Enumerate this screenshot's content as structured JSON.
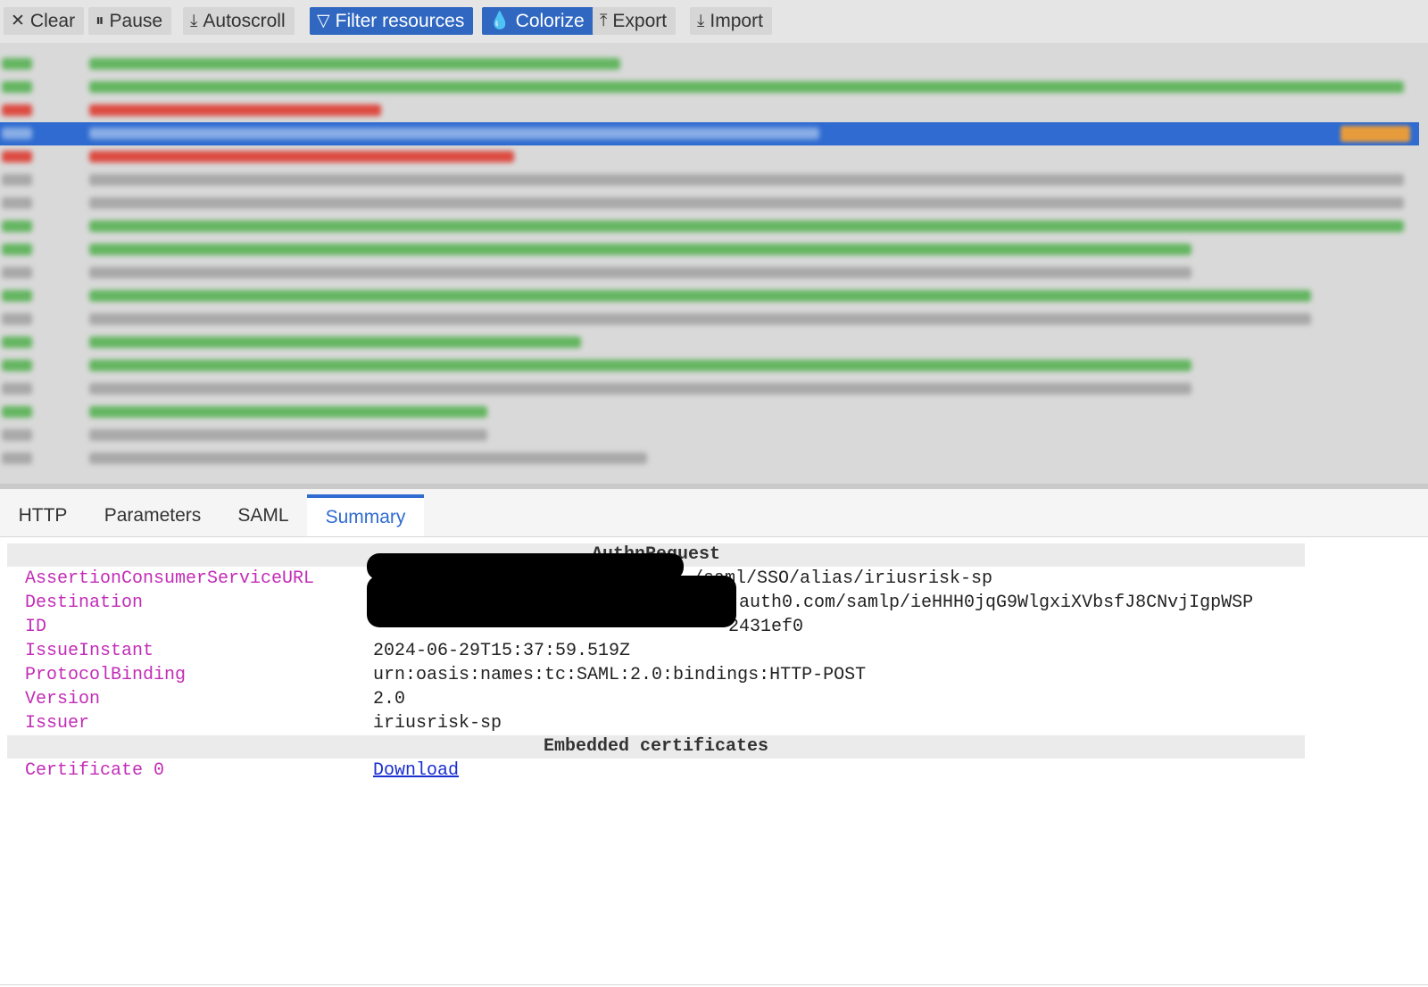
{
  "toolbar": {
    "clear_label": "Clear",
    "pause_label": "Pause",
    "autoscroll_label": "Autoscroll",
    "filter_label": "Filter resources",
    "colorize_label": "Colorize",
    "export_label": "Export",
    "import_label": "Import",
    "active_color": "#2f67c1"
  },
  "request_list": {
    "note_colors": {
      "green": "#63b560",
      "red": "#dc4a40",
      "grey": "#a8a8a8",
      "selected": "#2f6bd0"
    },
    "rows": [
      {
        "color": "green",
        "url_length": 0.4,
        "selected": false
      },
      {
        "color": "green",
        "url_length": 0.99,
        "selected": false
      },
      {
        "color": "red",
        "url_length": 0.22,
        "selected": false
      },
      {
        "color": "blue",
        "url_length": 0.55,
        "selected": true
      },
      {
        "color": "red",
        "url_length": 0.32,
        "selected": false
      },
      {
        "color": "grey",
        "url_length": 0.99,
        "selected": false
      },
      {
        "color": "grey",
        "url_length": 0.99,
        "selected": false
      },
      {
        "color": "green",
        "url_length": 0.99,
        "selected": false
      },
      {
        "color": "green",
        "url_length": 0.83,
        "selected": false
      },
      {
        "color": "grey",
        "url_length": 0.83,
        "selected": false
      },
      {
        "color": "green",
        "url_length": 0.92,
        "selected": false
      },
      {
        "color": "grey",
        "url_length": 0.92,
        "selected": false
      },
      {
        "color": "green",
        "url_length": 0.37,
        "selected": false
      },
      {
        "color": "green",
        "url_length": 0.83,
        "selected": false
      },
      {
        "color": "grey",
        "url_length": 0.83,
        "selected": false
      },
      {
        "color": "green",
        "url_length": 0.3,
        "selected": false
      },
      {
        "color": "grey",
        "url_length": 0.3,
        "selected": false
      },
      {
        "color": "grey",
        "url_length": 0.42,
        "selected": false
      }
    ]
  },
  "tabs": {
    "http": "HTTP",
    "parameters": "Parameters",
    "saml": "SAML",
    "summary": "Summary",
    "active": "Summary"
  },
  "summary": {
    "authn_header": "AuthnRequest",
    "fields": {
      "acs_key": "AssertionConsumerServiceURL",
      "acs_value": "/saml/SSO/alias/iriusrisk-sp",
      "destination_key": "Destination",
      "destination_value": "auth0.com/samlp/ieHHH0jqG9WlgxiXVbsfJ8CNvjIgpWSP",
      "id_key": "ID",
      "id_value": "2431ef0",
      "issue_instant_key": "IssueInstant",
      "issue_instant_value": "2024-06-29T15:37:59.519Z",
      "protocol_binding_key": "ProtocolBinding",
      "protocol_binding_value": "urn:oasis:names:tc:SAML:2.0:bindings:HTTP-POST",
      "version_key": "Version",
      "version_value": "2.0",
      "issuer_key": "Issuer",
      "issuer_value": "iriusrisk-sp"
    },
    "certs_header": "Embedded certificates",
    "cert0_key": "Certificate 0",
    "cert0_link": "Download"
  }
}
